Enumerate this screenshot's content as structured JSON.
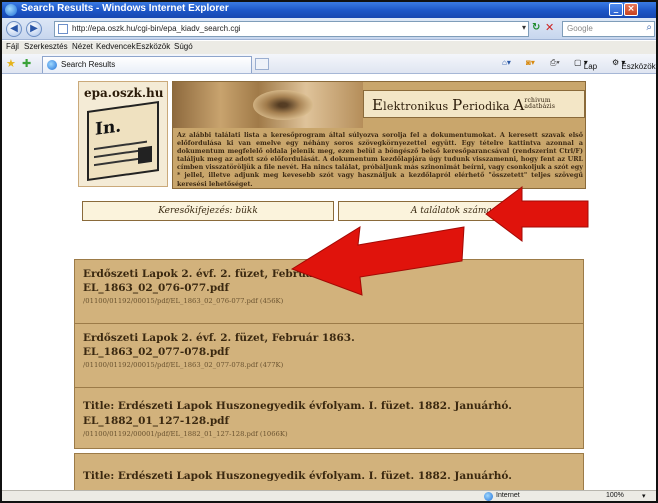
{
  "window": {
    "title": "Search Results - Windows Internet Explorer"
  },
  "address": {
    "url": "http://epa.oszk.hu/cgi-bin/epa_kiadv_search.cgi",
    "search_placeholder": "Google"
  },
  "menu": [
    "Fájl",
    "Szerkesztés",
    "Nézet",
    "Kedvencek",
    "Eszközök",
    "Súgó"
  ],
  "tab": {
    "label": "Search Results"
  },
  "command_bar": {
    "page_label": "Lap",
    "tools_label": "Eszközök"
  },
  "header": {
    "logo_text": "epa.oszk.hu",
    "logo_book_text": "In.",
    "title_e": "E",
    "title_lektronikus": "lektronikus",
    "title_p": "P",
    "title_eriodika": "eriodika",
    "title_a": "A",
    "title_rchivum": "rchivum",
    "title_adatbazis": "adatbázis",
    "intro": "Az alábbi találati lista a keresőprogram által súlyozva sorolja fel a dokumentumokat. A keresett szavak első előfordulása ki van emelve egy néhány soros szövegkörnyezettel együtt. Egy tételre kattintva azonnal a dokumentum megfelelő oldala jelenik meg, ezen belül a böngésző belső keresőparancsával (rendszerint Ctrl/F) találjuk meg az adott szó előfordulását. A dokumentum kezdőlapjára úgy tudunk visszamenni, hogy fent az URL címben visszatöröljük a file nevét. Ha nincs találat, próbáljunk más szinonimát beírni, vagy csonkoljuk a szót egy * jellel, illetve adjunk meg kevesebb szót vagy használjuk a kezdőlapról elérhető \"összetett\" teljes szövegű keresési lehetőséget."
  },
  "search_info": {
    "query": "Keresőkifejezés: bükk",
    "count": "A találatok száma: 17"
  },
  "results": [
    {
      "title": "Erdőszeti Lapok 2. évf. 2. füzet, Február 1863.",
      "file": "EL_1863_02_076-077.pdf",
      "path": "/01100/01192/00015/pdf/EL_1863_02_076-077.pdf (456K)"
    },
    {
      "title": "Erdőszeti Lapok 2. évf. 2. füzet, Február 1863.",
      "file": "EL_1863_02_077-078.pdf",
      "path": "/01100/01192/00015/pdf/EL_1863_02_077-078.pdf (477K)"
    },
    {
      "title": "Title: Erdészeti Lapok Huszonegyedik évfolyam. I. füzet. 1882. Januárhó.",
      "file": "EL_1882_01_127-128.pdf",
      "path": "/01100/01192/00001/pdf/EL_1882_01_127-128.pdf (1066K)"
    },
    {
      "title": "Title: Erdészeti Lapok Huszonegyedik évfolyam. I. füzet. 1882. Januárhó."
    }
  ],
  "status": {
    "zone": "Internet",
    "zoom": "100%"
  },
  "colors": {
    "arrow": "#e0130c",
    "result_bg": "#d2b27c",
    "banner_bg": "#c9a66c",
    "titlebar": "#1c55c6"
  }
}
